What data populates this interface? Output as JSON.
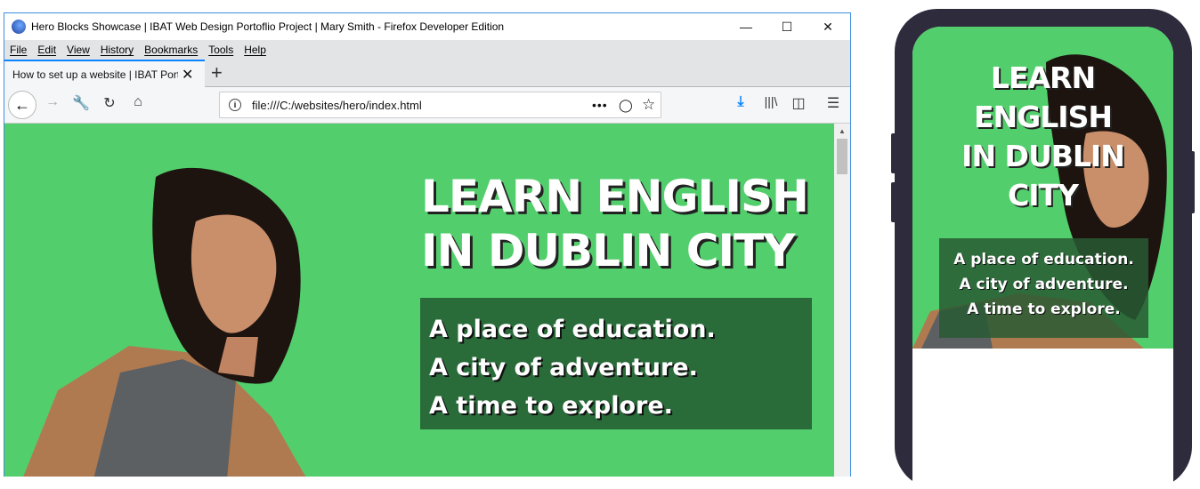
{
  "window": {
    "title": "Hero Blocks Showcase | IBAT Web Design Portoflio Project | Mary Smith - Firefox Developer Edition"
  },
  "menu": [
    "File",
    "Edit",
    "View",
    "History",
    "Bookmarks",
    "Tools",
    "Help"
  ],
  "tab": {
    "label": "How to set up a website | IBAT Portoflio Project"
  },
  "url": "file:///C:/websites/hero/index.html",
  "hero": {
    "title_line1": "LEARN ENGLISH",
    "title_line2": "IN DUBLIN CITY",
    "tagline": [
      "A place of education.",
      "A city of adventure.",
      "A time to explore."
    ]
  },
  "mobile": {
    "title_lines": [
      "LEARN",
      "ENGLISH",
      "IN DUBLIN",
      "CITY"
    ]
  },
  "colors": {
    "hero_bg": "#52cf6c",
    "tag_bg": "#2a6b3a",
    "accent": "#0a84ff"
  }
}
